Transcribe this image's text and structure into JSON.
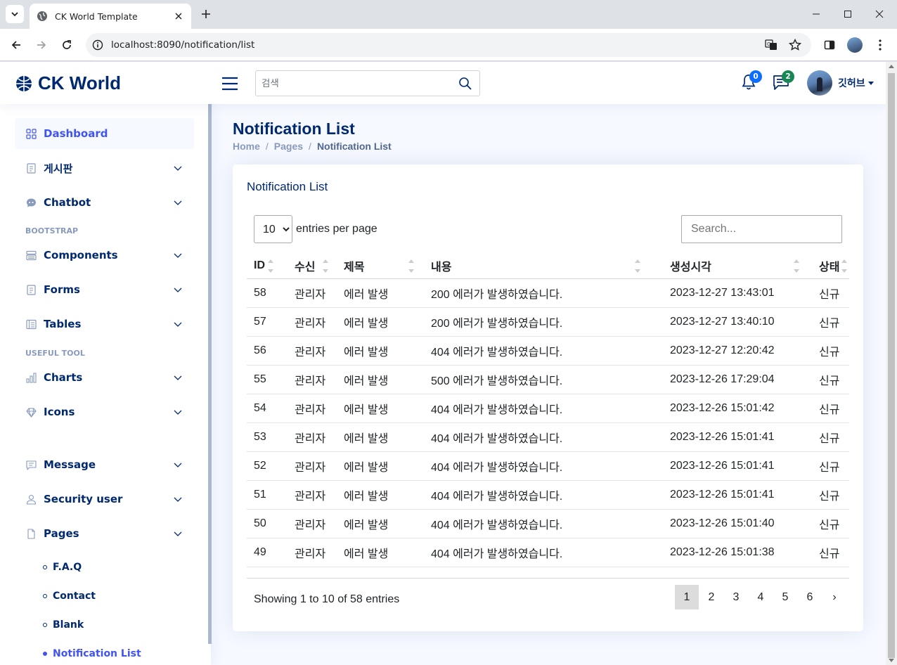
{
  "browser": {
    "tab_title": "CK World Template",
    "url": "localhost:8090/notification/list"
  },
  "header": {
    "logo_text": "CK World",
    "search_placeholder": "검색",
    "notifications_count": "0",
    "messages_count": "2",
    "username": "깃허브",
    "colors": {
      "brand": "#012970",
      "accent": "#4154f1",
      "notif_badge": "#0d6efd",
      "msg_badge": "#198754"
    }
  },
  "sidebar": {
    "items": [
      {
        "label": "Dashboard",
        "icon": "grid-icon",
        "active": true,
        "expandable": false
      },
      {
        "label": "게시판",
        "icon": "journal-icon",
        "expandable": true
      },
      {
        "label": "Chatbot",
        "icon": "chat-quote-icon",
        "expandable": true
      }
    ],
    "heading_bootstrap": "BOOTSTRAP",
    "bootstrap_items": [
      {
        "label": "Components",
        "icon": "menu-button-icon"
      },
      {
        "label": "Forms",
        "icon": "journal-text-icon"
      },
      {
        "label": "Tables",
        "icon": "layout-text-icon"
      }
    ],
    "heading_useful": "USEFUL TOOL",
    "useful_items": [
      {
        "label": "Charts",
        "icon": "bar-chart-icon"
      },
      {
        "label": "Icons",
        "icon": "gem-icon"
      }
    ],
    "other_items": [
      {
        "label": "Message",
        "icon": "message-icon"
      },
      {
        "label": "Security user",
        "icon": "person-icon"
      },
      {
        "label": "Pages",
        "icon": "file-icon"
      }
    ],
    "sub_items": [
      {
        "label": "F.A.Q",
        "active": false
      },
      {
        "label": "Contact",
        "active": false
      },
      {
        "label": "Blank",
        "active": false
      },
      {
        "label": "Notification List",
        "active": true
      }
    ]
  },
  "main": {
    "page_title": "Notification List",
    "breadcrumb": [
      "Home",
      "Pages",
      "Notification List"
    ],
    "card_title": "Notification List",
    "per_page_value": "10",
    "per_page_text": "entries per page",
    "search_placeholder": "Search...",
    "columns": [
      "ID",
      "수신",
      "제목",
      "내용",
      "생성시각",
      "상태"
    ],
    "rows": [
      [
        "58",
        "관리자",
        "에러 발생",
        "200 에러가 발생하였습니다.",
        "2023-12-27 13:43:01",
        "신규"
      ],
      [
        "57",
        "관리자",
        "에러 발생",
        "200 에러가 발생하였습니다.",
        "2023-12-27 13:40:10",
        "신규"
      ],
      [
        "56",
        "관리자",
        "에러 발생",
        "404 에러가 발생하였습니다.",
        "2023-12-27 12:20:42",
        "신규"
      ],
      [
        "55",
        "관리자",
        "에러 발생",
        "500 에러가 발생하였습니다.",
        "2023-12-26 17:29:04",
        "신규"
      ],
      [
        "54",
        "관리자",
        "에러 발생",
        "404 에러가 발생하였습니다.",
        "2023-12-26 15:01:42",
        "신규"
      ],
      [
        "53",
        "관리자",
        "에러 발생",
        "404 에러가 발생하였습니다.",
        "2023-12-26 15:01:41",
        "신규"
      ],
      [
        "52",
        "관리자",
        "에러 발생",
        "404 에러가 발생하였습니다.",
        "2023-12-26 15:01:41",
        "신규"
      ],
      [
        "51",
        "관리자",
        "에러 발생",
        "404 에러가 발생하였습니다.",
        "2023-12-26 15:01:41",
        "신규"
      ],
      [
        "50",
        "관리자",
        "에러 발생",
        "404 에러가 발생하였습니다.",
        "2023-12-26 15:01:40",
        "신규"
      ],
      [
        "49",
        "관리자",
        "에러 발생",
        "404 에러가 발생하였습니다.",
        "2023-12-26 15:01:38",
        "신규"
      ]
    ],
    "info_text": "Showing 1 to 10 of 58 entries",
    "pages": [
      "1",
      "2",
      "3",
      "4",
      "5",
      "6",
      "›"
    ],
    "current_page": "1"
  }
}
